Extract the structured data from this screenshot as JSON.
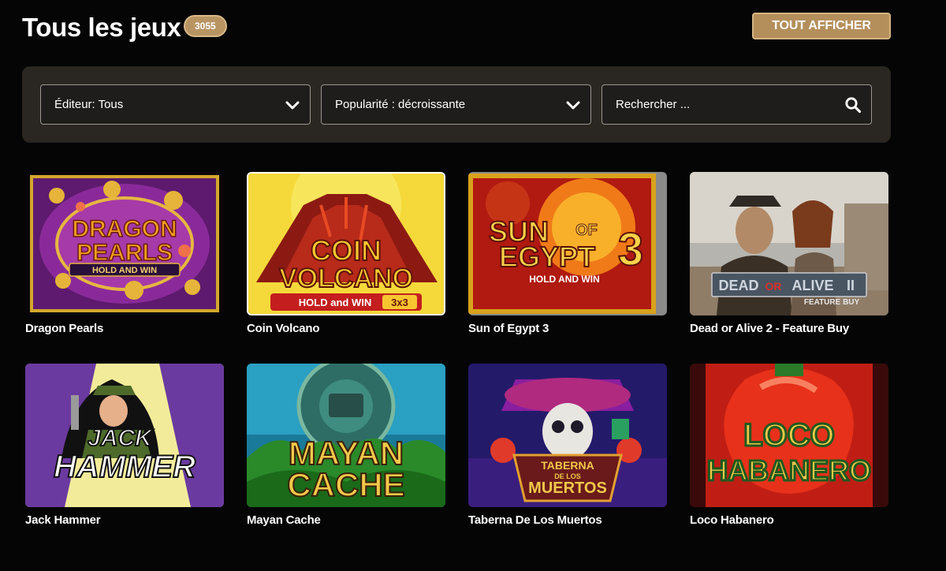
{
  "header": {
    "title": "Tous les jeux",
    "count": "3055",
    "show_all_label": "TOUT AFFICHER"
  },
  "filters": {
    "editor_label": "Éditeur: Tous",
    "popularity_label": "Popularité : décroissante",
    "search_placeholder": "Rechercher ..."
  },
  "games": [
    {
      "name": "Dragon Pearls",
      "art": [
        "DRAGON",
        "PEARLS",
        "HOLD AND WIN"
      ]
    },
    {
      "name": "Coin Volcano",
      "art": [
        "COIN",
        "VOLCANO",
        "HOLD and WIN",
        "3x3"
      ]
    },
    {
      "name": "Sun of Egypt 3",
      "art": [
        "SUN",
        "OF",
        "EGYPT",
        "3",
        "HOLD AND WIN"
      ]
    },
    {
      "name": "Dead or Alive 2 - Feature Buy",
      "art": [
        "DEAD",
        "OR",
        "ALIVE",
        "II",
        "FEATURE BUY"
      ]
    },
    {
      "name": "Jack Hammer",
      "art": [
        "JACK",
        "HAMMER"
      ]
    },
    {
      "name": "Mayan Cache",
      "art": [
        "MAYAN",
        "CACHE"
      ]
    },
    {
      "name": "Taberna De Los Muertos",
      "art": [
        "TABERNA",
        "DE LOS",
        "MUERTOS"
      ]
    },
    {
      "name": "Loco Habanero",
      "art": [
        "LOCO",
        "HABANERO"
      ]
    }
  ],
  "colors": {
    "accent_gold": "#b48f5c",
    "panel": "#2a2621",
    "background": "#050505"
  },
  "icons": {
    "dropdown": "chevron-down-icon",
    "search": "search-icon"
  }
}
